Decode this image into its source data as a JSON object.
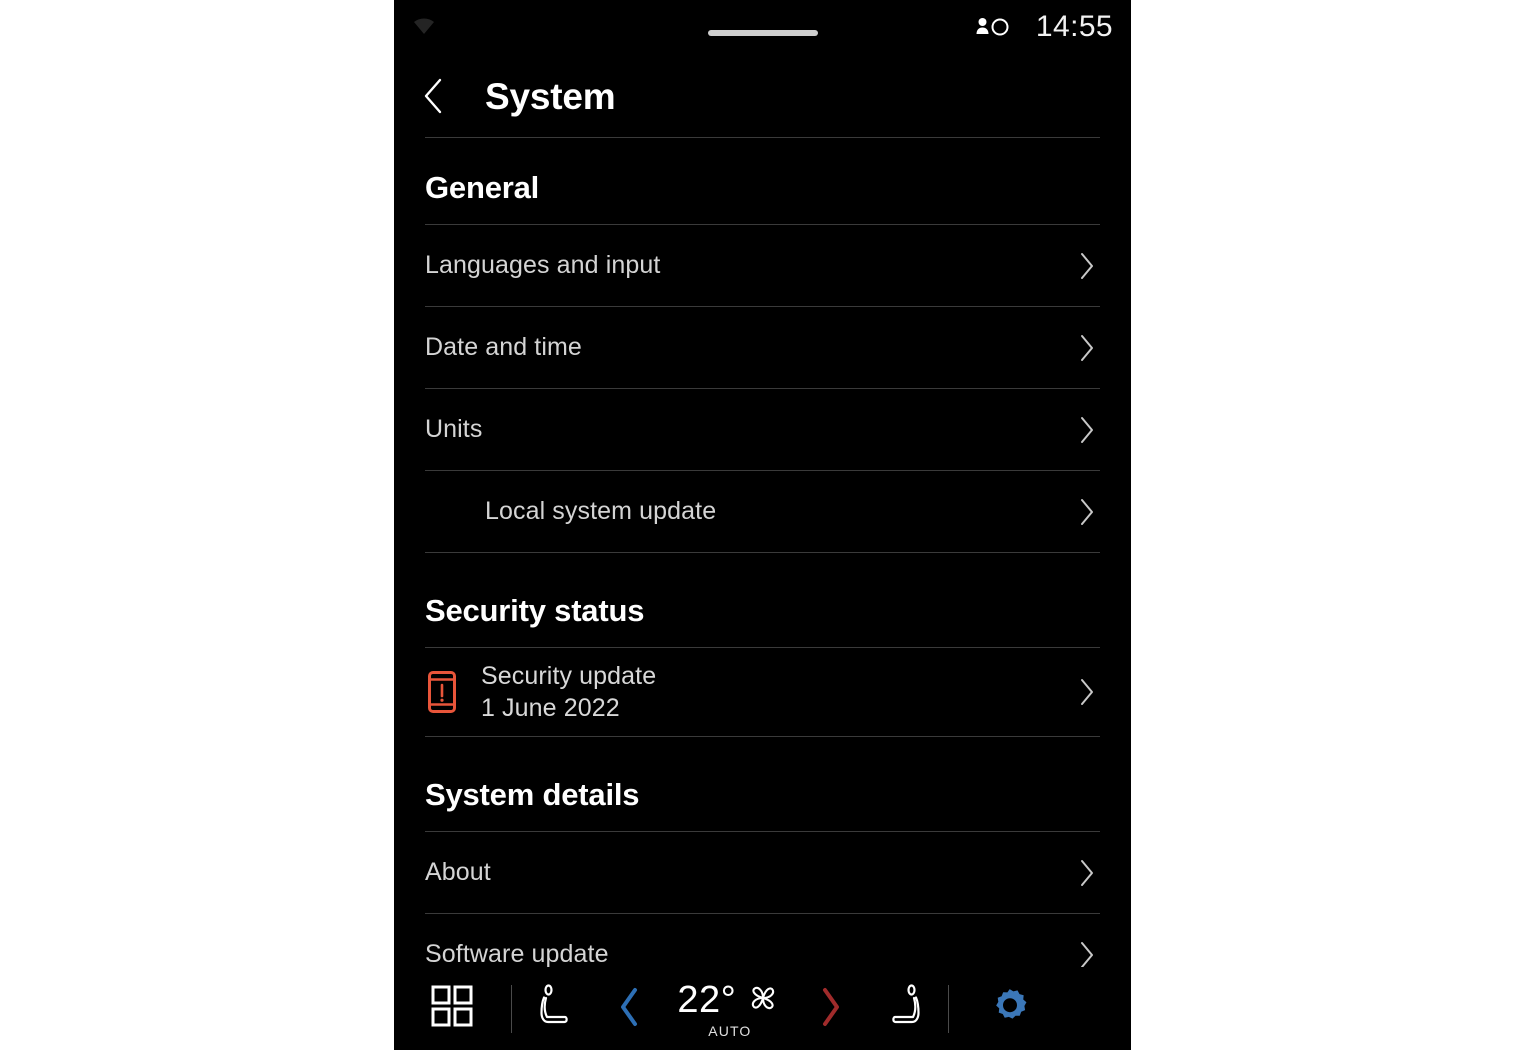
{
  "status_bar": {
    "wifi_icon": "wifi-icon",
    "profile_icon": "profile-icon",
    "clock": "14:55",
    "drag_handle": "drag-handle"
  },
  "header": {
    "back_icon": "chevron-left-icon",
    "title": "System"
  },
  "sections": [
    {
      "id": "general",
      "heading": "General",
      "rows": [
        {
          "label": "Languages and input",
          "indented": false,
          "chevron": "chevron-right-icon"
        },
        {
          "label": "Date and time",
          "indented": false,
          "chevron": "chevron-right-icon"
        },
        {
          "label": "Units",
          "indented": false,
          "chevron": "chevron-right-icon"
        },
        {
          "label": "Local system update",
          "indented": true,
          "chevron": "chevron-right-icon"
        }
      ]
    },
    {
      "id": "security-status",
      "heading": "Security status",
      "security_row": {
        "icon": "device-alert-icon",
        "icon_color": "#E8553A",
        "title": "Security update",
        "subtitle": "1 June 2022",
        "chevron": "chevron-right-icon"
      }
    },
    {
      "id": "system-details",
      "heading": "System details",
      "rows": [
        {
          "label": "About",
          "indented": false,
          "chevron": "chevron-right-icon"
        },
        {
          "label": "Software update",
          "indented": false,
          "chevron": "chevron-right-icon"
        }
      ]
    }
  ],
  "bottom_bar": {
    "apps_icon": "apps-grid-icon",
    "left_seat_icon": "seat-heater-left-icon",
    "temp_down_icon": "chevron-left-icon",
    "temperature": "22°",
    "fan_icon": "fan-icon",
    "auto_label": "AUTO",
    "temp_up_icon": "chevron-right-icon",
    "right_seat_icon": "seat-heater-right-icon",
    "settings_icon": "gear-icon",
    "colors": {
      "cool_accent": "#2D6FB5",
      "warm_accent": "#A02B2B",
      "settings_accent": "#3B77B8"
    }
  }
}
